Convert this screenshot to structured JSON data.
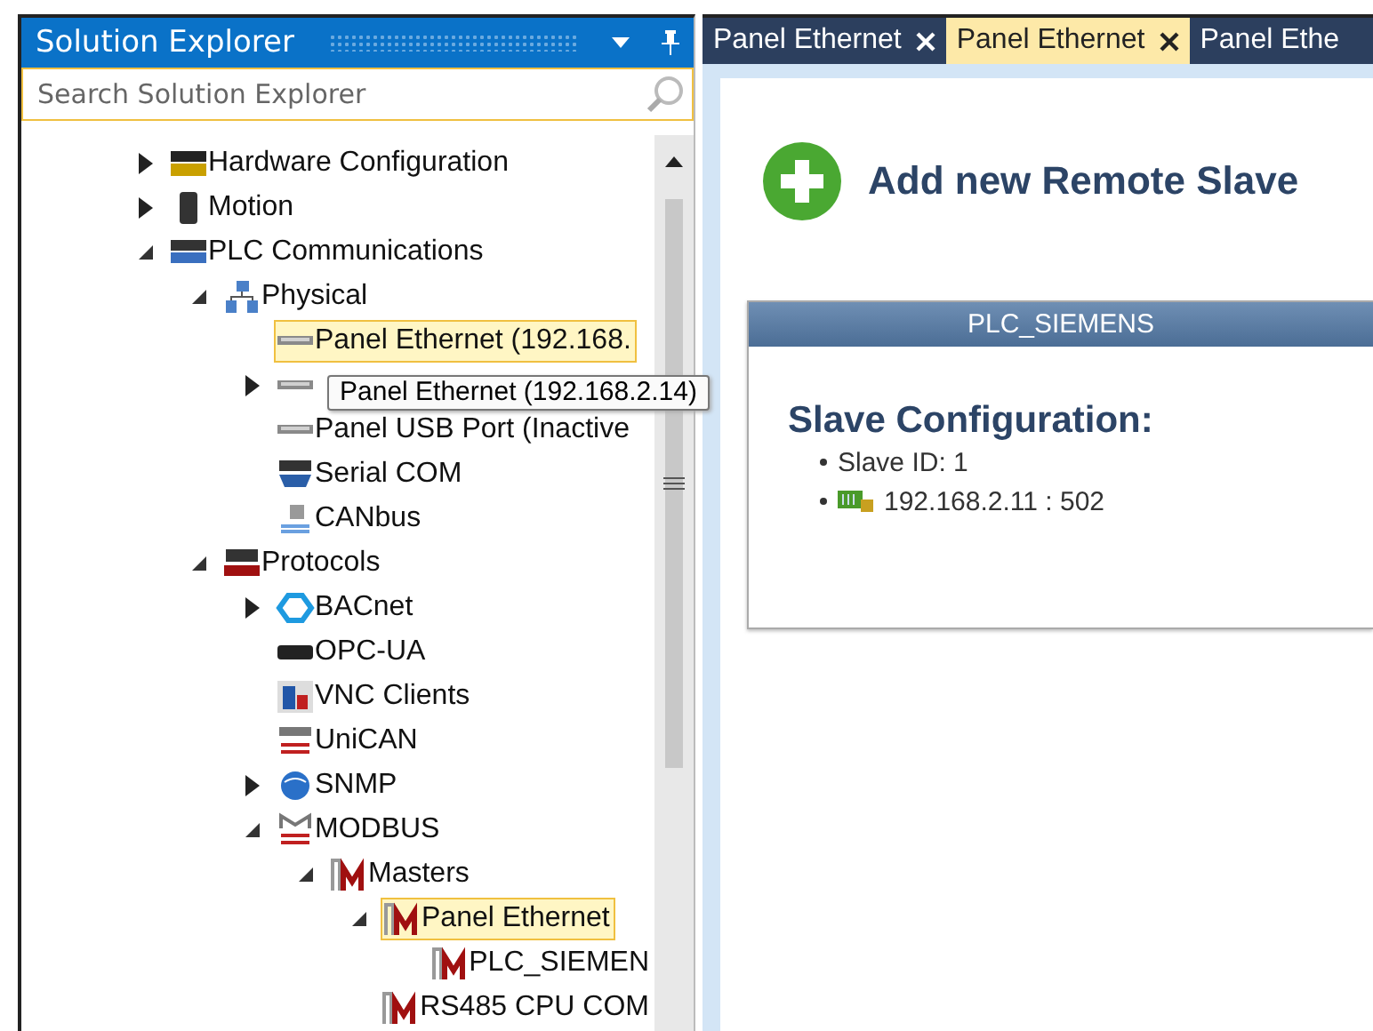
{
  "explorer": {
    "title": "Solution Explorer",
    "search": {
      "placeholder": "Search Solution Explorer"
    }
  },
  "tree": {
    "items": [
      {
        "label": "Hardware Configuration",
        "kind": "hwc",
        "expanded": false,
        "selected": false
      },
      {
        "label": "Motion",
        "kind": "motion",
        "expanded": false,
        "selected": false
      },
      {
        "label": "PLC Communications",
        "kind": "com",
        "expanded": true,
        "selected": false,
        "children": [
          {
            "label": "Physical",
            "kind": "network",
            "expanded": true,
            "selected": false,
            "children": [
              {
                "label": "Panel Ethernet (192.168.",
                "kind": "panel",
                "selected": true
              },
              {
                "kind": "panel",
                "expanded": false,
                "selected": false
              },
              {
                "label": "Panel USB Port (Inactive",
                "kind": "panel",
                "selected": false
              },
              {
                "label": "Serial COM",
                "kind": "serial",
                "selected": false
              },
              {
                "label": "CANbus",
                "kind": "canbus",
                "selected": false
              }
            ]
          },
          {
            "label": "Protocols",
            "kind": "protocols",
            "expanded": true,
            "selected": false,
            "children": [
              {
                "label": "BACnet",
                "kind": "bacnet",
                "expanded": false,
                "selected": false
              },
              {
                "label": "OPC-UA",
                "kind": "opc",
                "selected": false
              },
              {
                "label": "VNC Clients",
                "kind": "vnc",
                "selected": false
              },
              {
                "label": "UniCAN",
                "kind": "unican",
                "selected": false
              },
              {
                "label": "SNMP",
                "kind": "snmp",
                "expanded": false,
                "selected": false
              },
              {
                "label": "MODBUS",
                "kind": "modbus",
                "expanded": true,
                "selected": false,
                "children": [
                  {
                    "label": "Masters",
                    "kind": "master",
                    "expanded": true,
                    "selected": false,
                    "children": [
                      {
                        "label": "Panel Ethernet",
                        "kind": "master",
                        "expanded": true,
                        "selected": true,
                        "children": [
                          {
                            "label": "PLC_SIEMEN",
                            "kind": "master",
                            "selected": false
                          }
                        ]
                      },
                      {
                        "label": "RS485 CPU COM",
                        "kind": "master",
                        "selected": false
                      }
                    ]
                  }
                ]
              }
            ]
          }
        ]
      }
    ]
  },
  "tooltip": "Panel Ethernet (192.168.2.14)",
  "tabs": [
    {
      "label": "Panel Ethernet",
      "selected": false,
      "closable": true
    },
    {
      "label": "Panel Ethernet",
      "selected": true,
      "closable": true
    },
    {
      "label": "Panel Ethe",
      "selected": false,
      "closable": false
    }
  ],
  "add_link": "Add new Remote Slave",
  "slave_card": {
    "header": "PLC_SIEMENS",
    "heading": "Slave Configuration:",
    "lines": [
      {
        "text": "Slave ID: 1",
        "kind": "plain"
      },
      {
        "text": "192.168.2.11 : 502",
        "kind": "device"
      }
    ]
  }
}
